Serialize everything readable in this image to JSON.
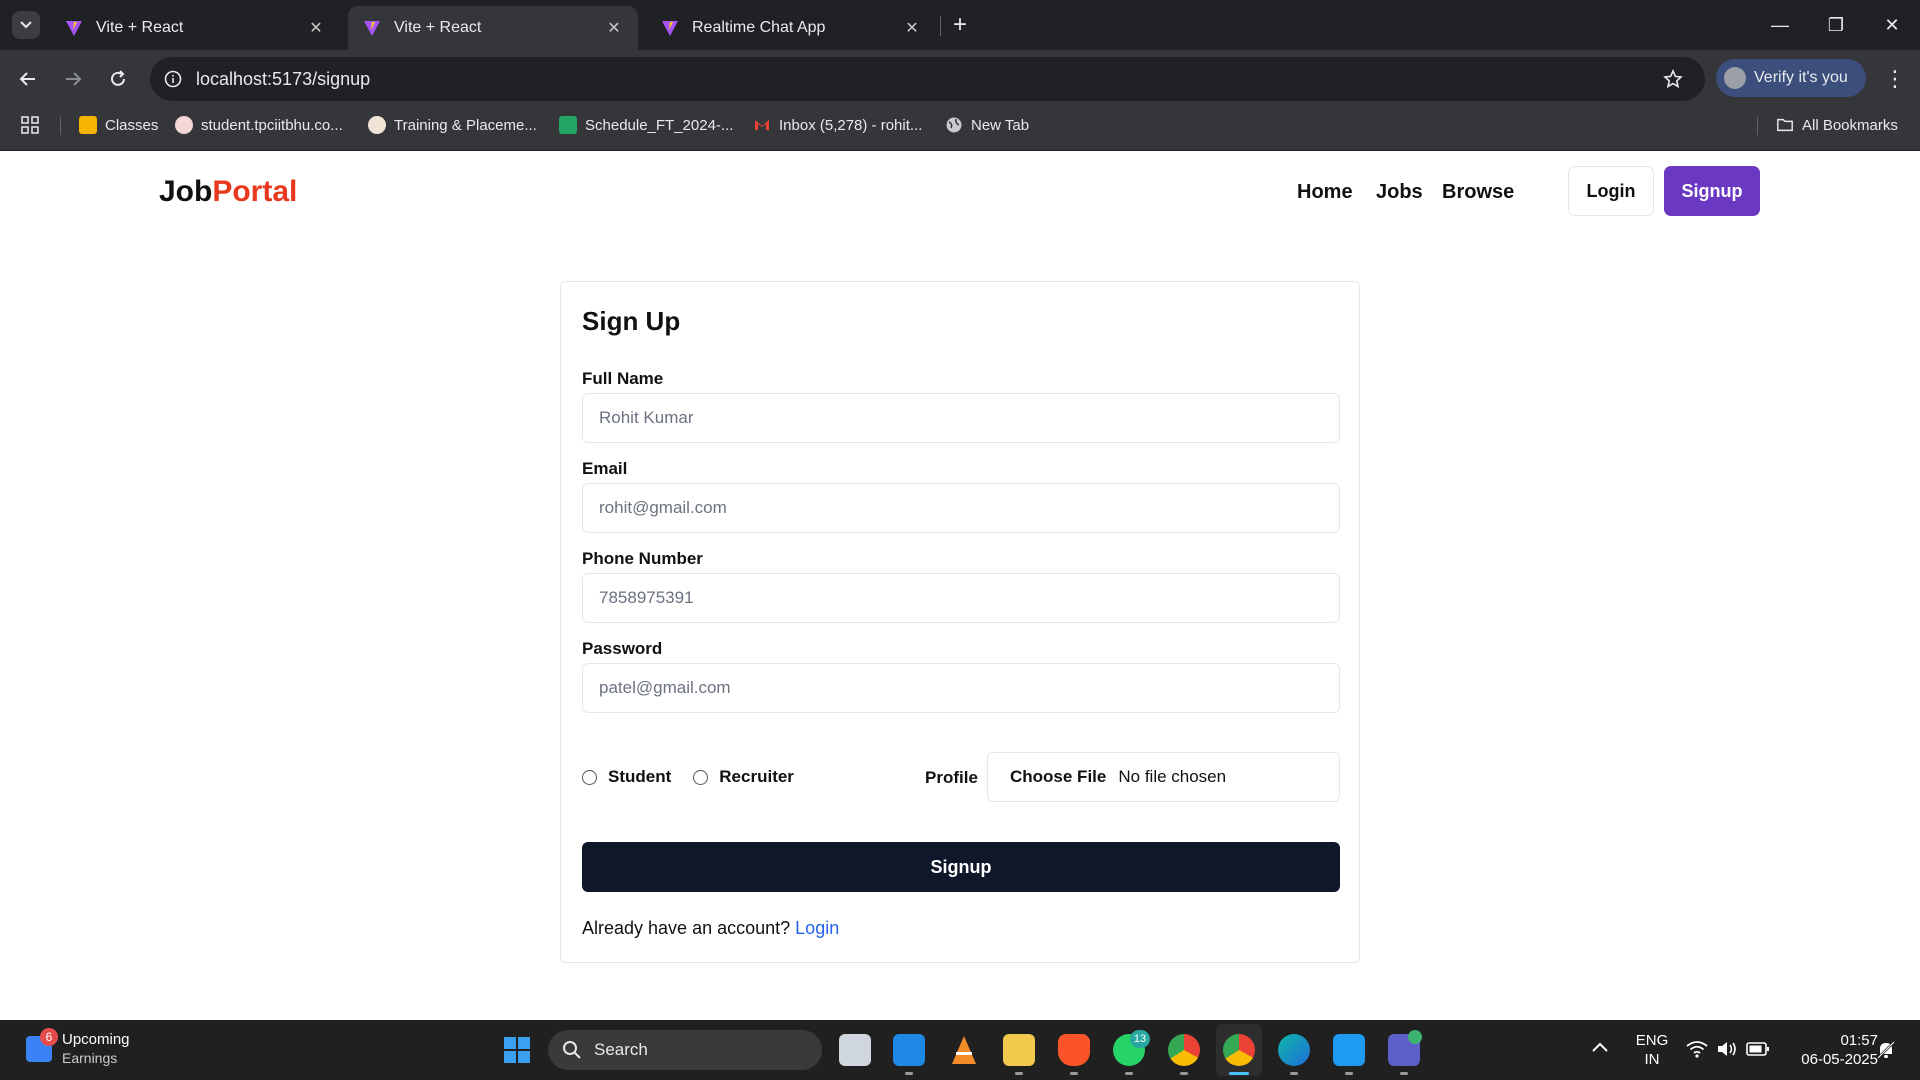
{
  "browser": {
    "tabs": [
      {
        "title": "Vite + React",
        "active": false
      },
      {
        "title": "Vite + React",
        "active": true
      },
      {
        "title": "Realtime Chat App",
        "active": false
      }
    ],
    "url": "localhost:5173/signup",
    "verify_label": "Verify it's you",
    "bookmarks": [
      {
        "label": "Classes",
        "icon": "classroom-icon"
      },
      {
        "label": "student.tpciitbhu.co...",
        "icon": "site-icon"
      },
      {
        "label": "Training & Placeme...",
        "icon": "site-icon"
      },
      {
        "label": "Schedule_FT_2024-...",
        "icon": "sheets-icon"
      },
      {
        "label": "Inbox (5,278) - rohit...",
        "icon": "gmail-icon"
      },
      {
        "label": "New Tab",
        "icon": "globe-icon"
      }
    ],
    "all_bookmarks_label": "All Bookmarks"
  },
  "navbar": {
    "logo_part1": "Job",
    "logo_part2": "Portal",
    "logo_accent_color": "#e8381e",
    "links": [
      "Home",
      "Jobs",
      "Browse"
    ],
    "login_label": "Login",
    "signup_label": "Signup",
    "signup_color": "#6a38c2"
  },
  "form": {
    "title": "Sign Up",
    "fields": [
      {
        "label": "Full Name",
        "placeholder": "Rohit Kumar"
      },
      {
        "label": "Email",
        "placeholder": "rohit@gmail.com"
      },
      {
        "label": "Phone Number",
        "placeholder": "7858975391"
      },
      {
        "label": "Password",
        "placeholder": "patel@gmail.com"
      }
    ],
    "roles": [
      "Student",
      "Recruiter"
    ],
    "profile_label": "Profile",
    "file_button": "Choose File",
    "file_status": "No file chosen",
    "submit_label": "Signup",
    "already_text": "Already have an account?",
    "login_link": "Login"
  },
  "taskbar": {
    "weather_badge": "6",
    "weather_title": "Upcoming",
    "weather_subtitle": "Earnings",
    "search_label": "Search",
    "whatsapp_badge": "13",
    "lang_line1": "ENG",
    "lang_line2": "IN",
    "time": "01:57",
    "date": "06-05-2025"
  }
}
